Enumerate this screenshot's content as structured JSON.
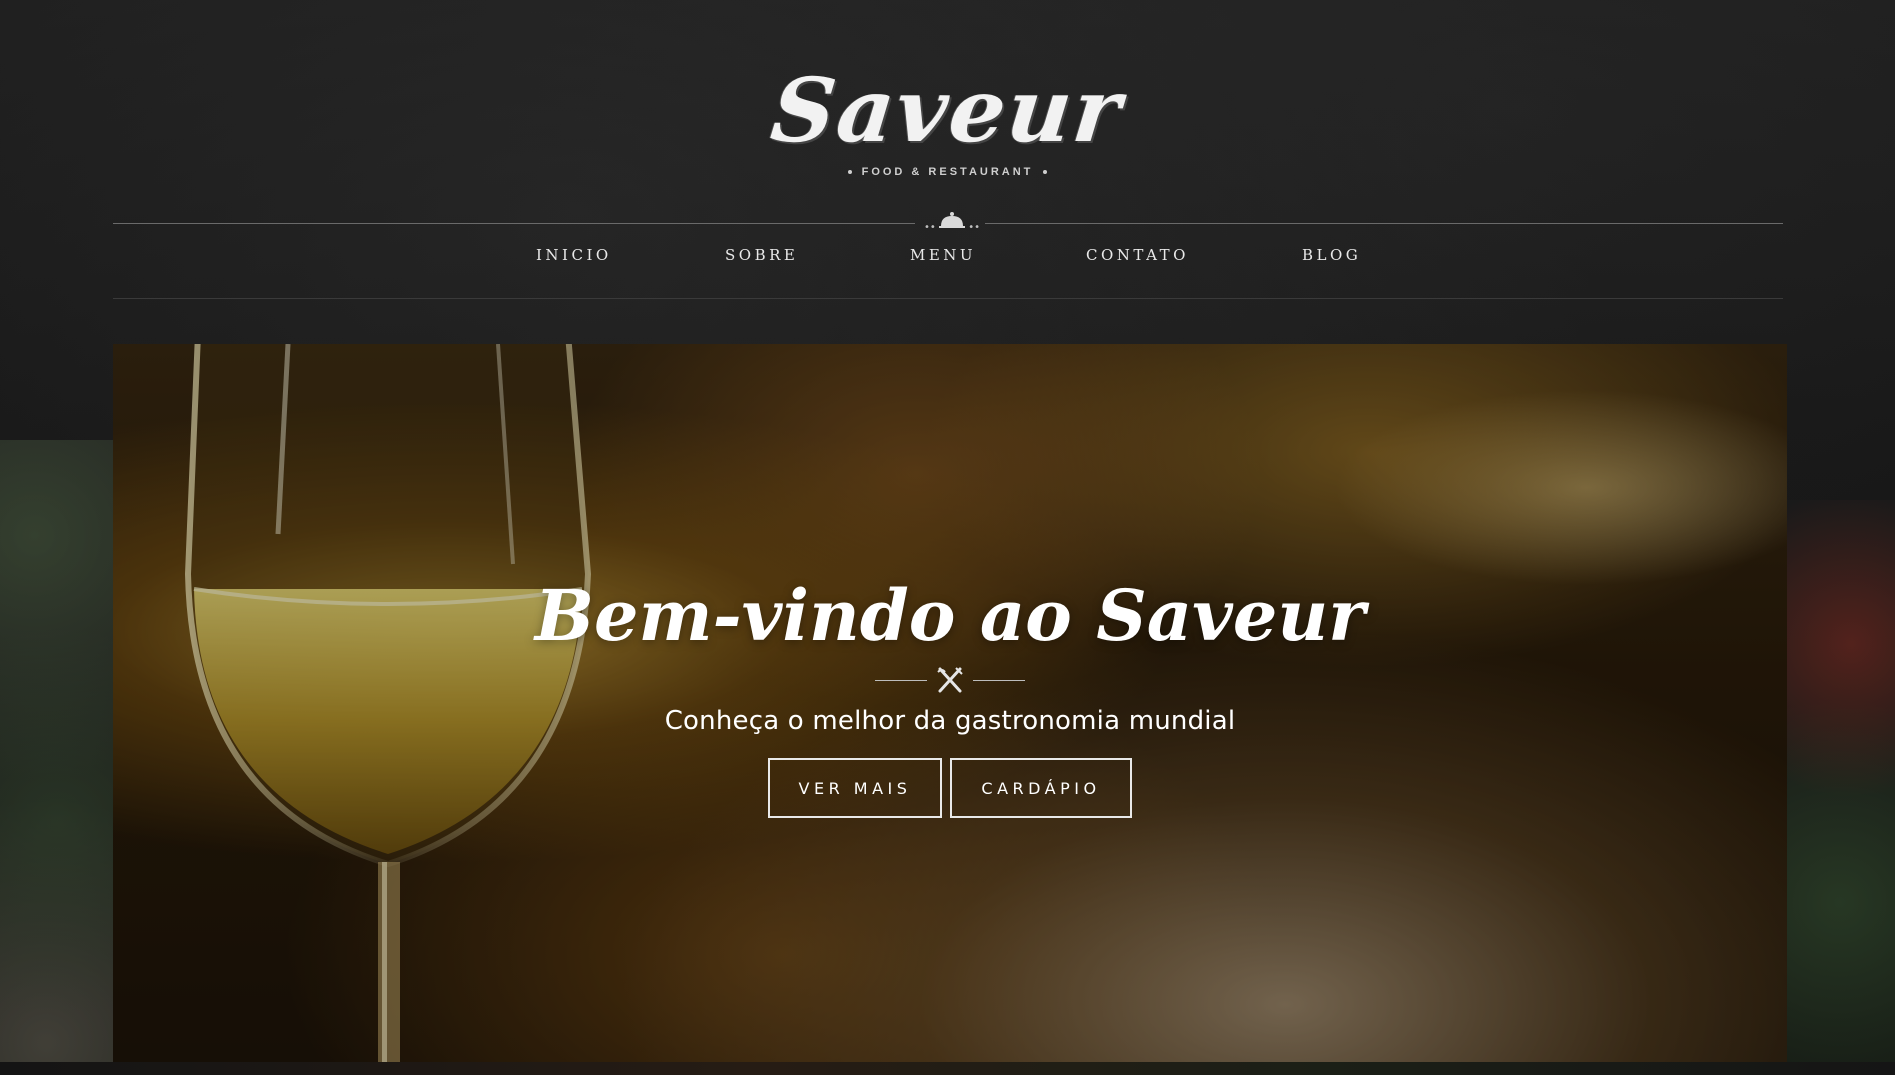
{
  "brand": {
    "logo_text": "Saveur",
    "tagline": "FOOD & RESTAURANT"
  },
  "nav": {
    "items": [
      {
        "label": "INICIO"
      },
      {
        "label": "SOBRE"
      },
      {
        "label": "MENU"
      },
      {
        "label": "CONTATO"
      },
      {
        "label": "BLOG"
      }
    ]
  },
  "hero": {
    "title": "Bem-vindo ao Saveur",
    "subtitle": "Conheça o melhor da gastronomia mundial",
    "buttons": {
      "primary_label": "VER MAIS",
      "secondary_label": "CARDÁPIO"
    }
  },
  "icons": {
    "divider": "cloche-icon",
    "ornament": "fork-knife-icon"
  },
  "colors": {
    "background": "#181818",
    "text": "#ffffff",
    "nav_text": "#e9e9e9"
  }
}
